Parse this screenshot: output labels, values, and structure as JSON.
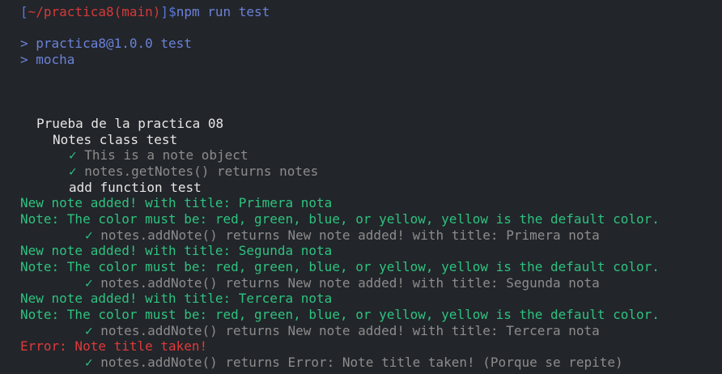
{
  "prompt": {
    "open_bracket": "[",
    "path": "~/practica8",
    "branch_open": "(",
    "branch": "main",
    "branch_close": ")",
    "close_bracket": "]",
    "dollar": "$",
    "command": "npm run test"
  },
  "npm_output": [
    "> practica8@1.0.0 test",
    "> mocha"
  ],
  "tests": {
    "suite": "Prueba de la practica 08",
    "subsuite": "Notes class test",
    "check_mark": "✓",
    "passed_1": "This is a note object",
    "passed_2": "notes.getNotes() returns notes",
    "subsuite_2": "add function test",
    "log_1": "New note added! with title: Primera nota",
    "color_note": "Note: The color must be: red, green, blue, or yellow, yellow is the default color.",
    "passed_3": "notes.addNote() returns New note added! with title: Primera nota",
    "log_2": "New note added! with title: Segunda nota",
    "passed_4": "notes.addNote() returns New note added! with title: Segunda nota",
    "log_3": "New note added! with title: Tercera nota",
    "passed_5": "notes.addNote() returns New note added! with title: Tercera nota",
    "error_1": "Error: Note title taken!",
    "passed_6": "notes.addNote() returns Error: Note title taken! (Porque se repite)"
  },
  "colors": {
    "background": "#22252a",
    "prompt_blue": "#5b78d8",
    "path_red": "#d63a3a",
    "pass_green": "#2ec27e",
    "error_red": "#e03a3a",
    "muted_gray": "#8c8c8c"
  }
}
